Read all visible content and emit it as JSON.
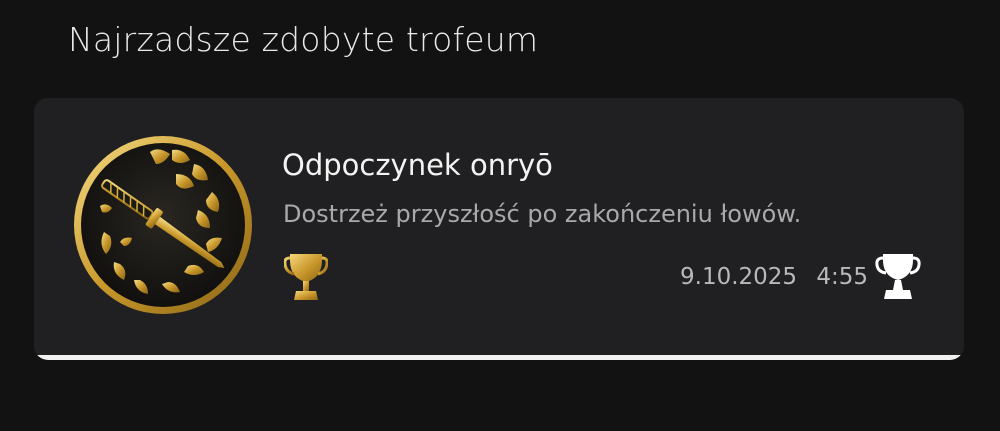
{
  "section": {
    "title": "Najrzadsze zdobyte trofeum"
  },
  "trophy": {
    "name": "Odpoczynek onryō",
    "description": "Dostrzeż przyszłość po zakończeniu łowów.",
    "grade_icon": "gold-trophy-icon",
    "earned_date": "9.10.2025",
    "earned_time": "4:55",
    "earned_icon": "trophy-earned-icon",
    "art_icon": "katana-ginkgo-emblem",
    "progress": 1.0
  },
  "colors": {
    "background": "#121213",
    "card": "#202022",
    "gold": "#d9b23a",
    "text_primary": "#f3f3f3",
    "text_secondary": "#a9a9ad"
  }
}
